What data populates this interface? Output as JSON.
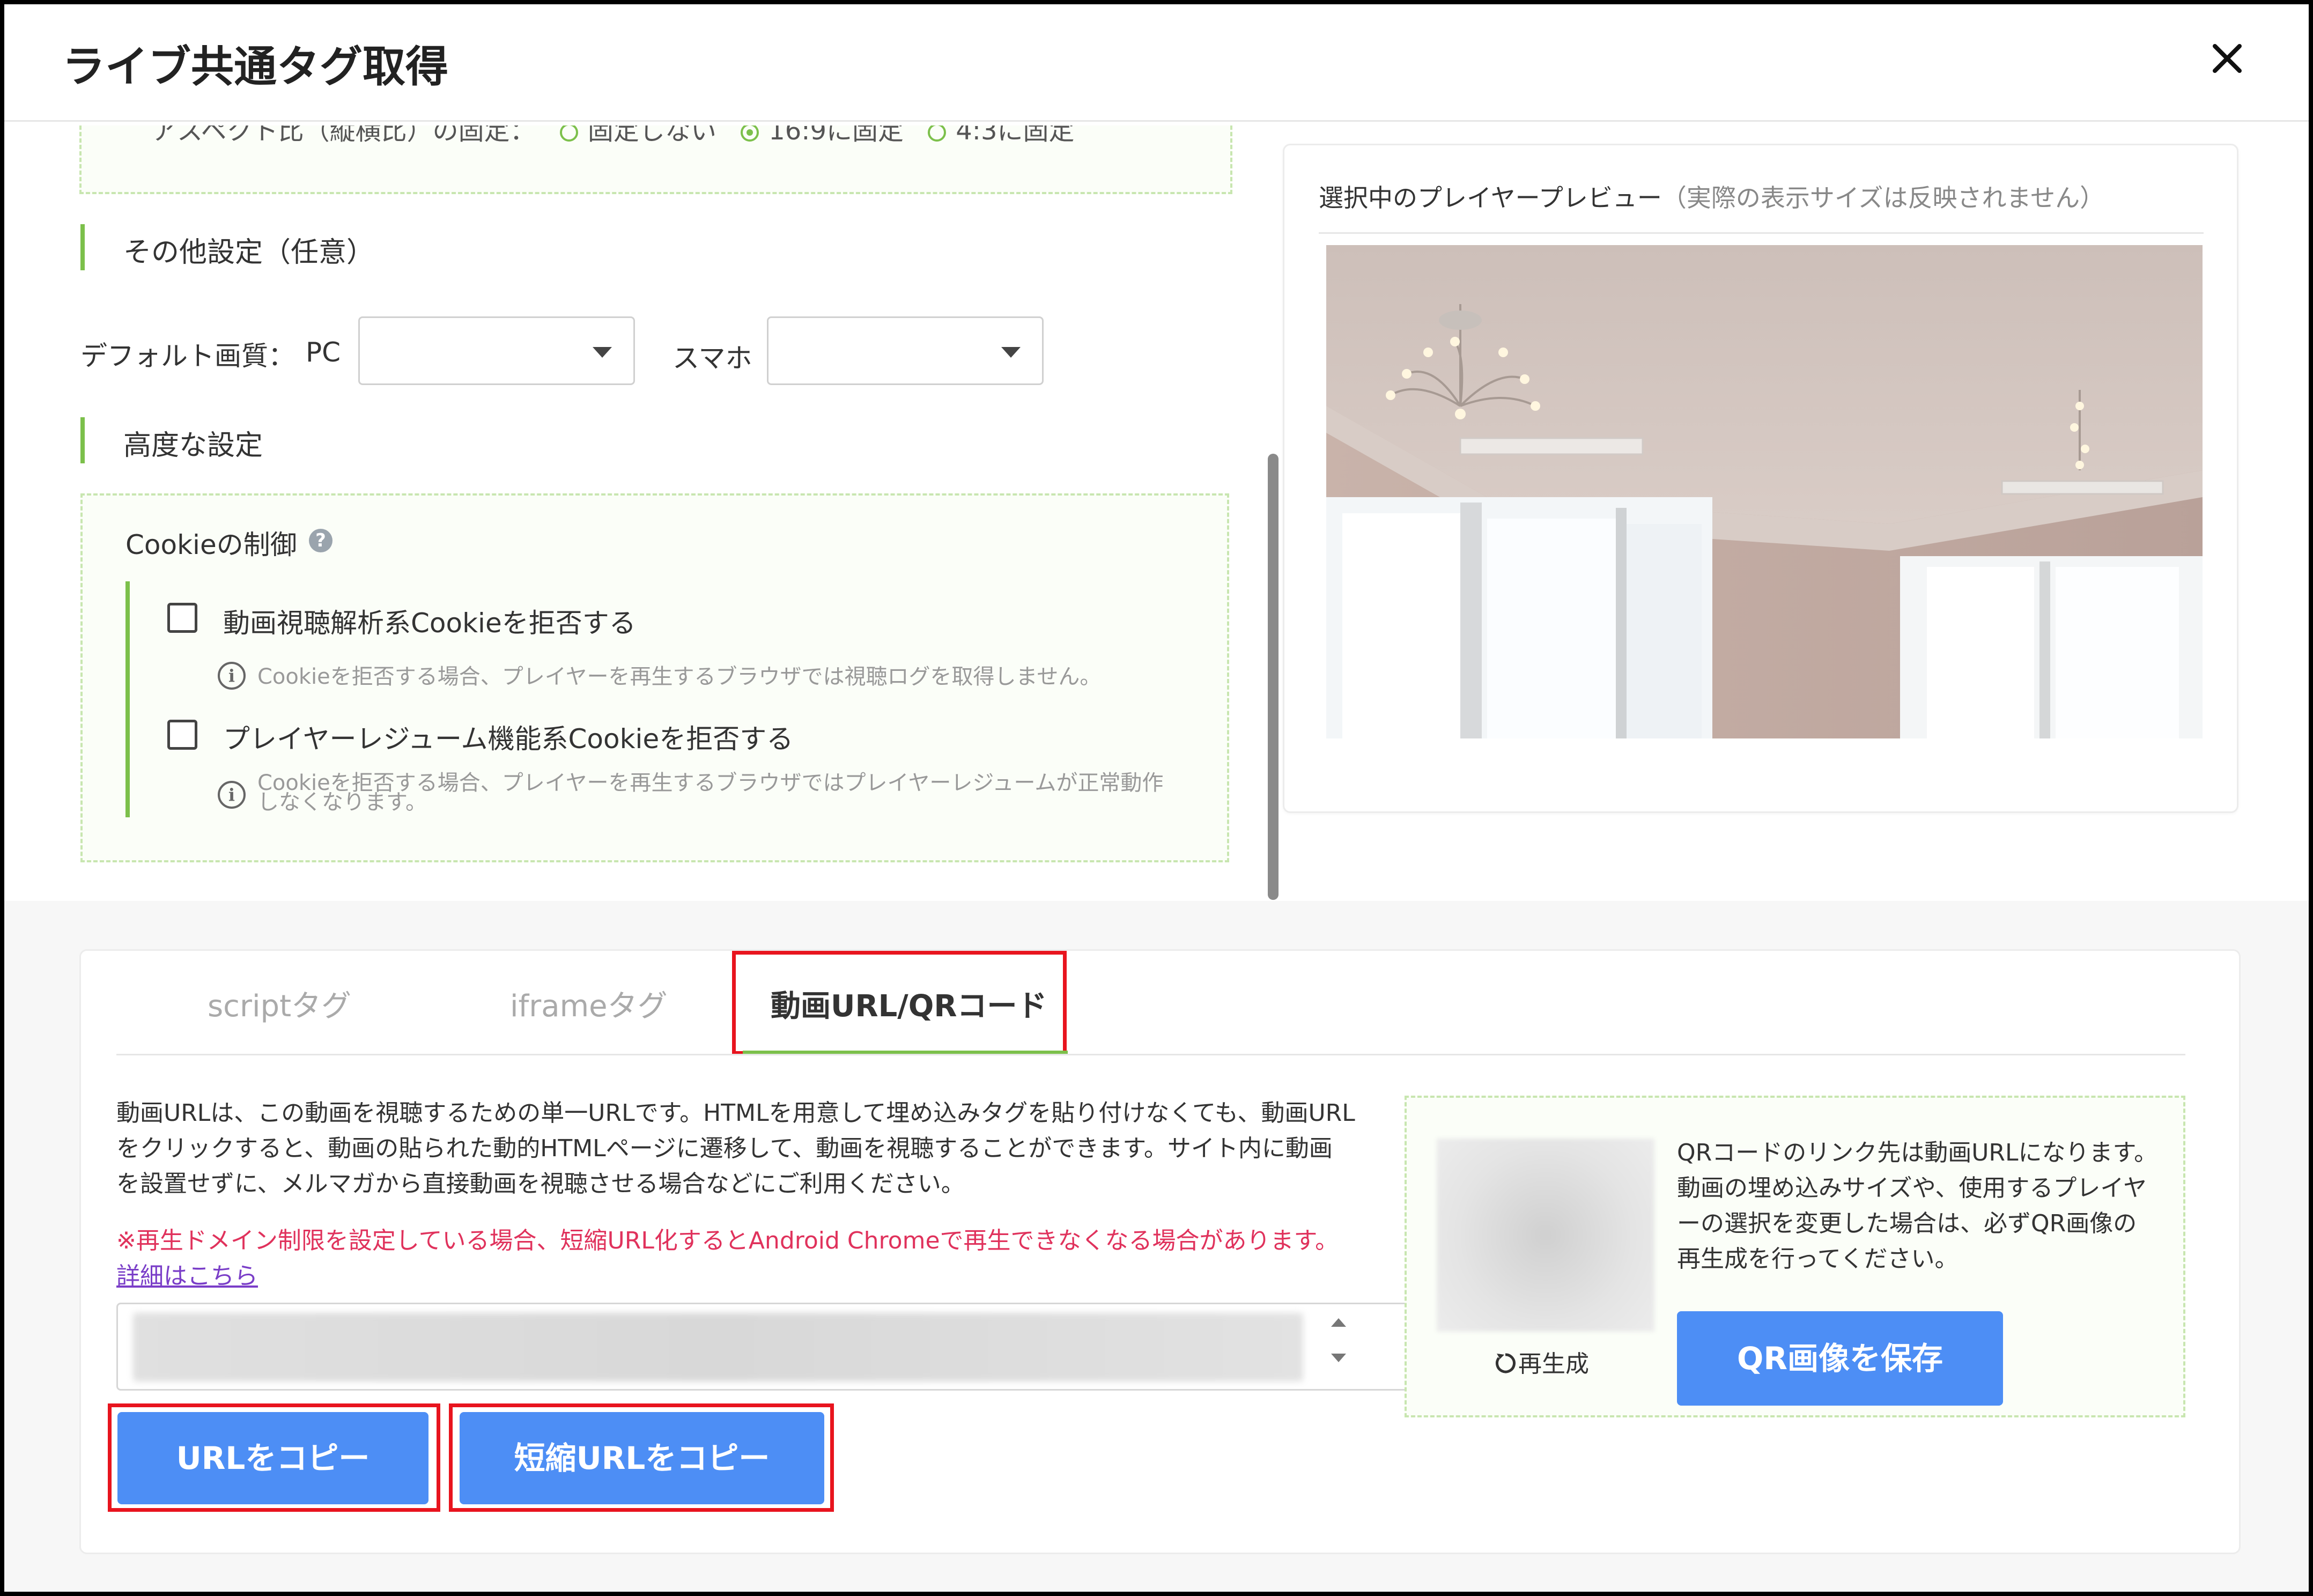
{
  "dialog": {
    "title": "ライブ共通タグ取得",
    "close_icon": "close-icon"
  },
  "aspect": {
    "label": "アスペクト比（縦横比）の固定：",
    "options": [
      "固定しない",
      "16:9に固定",
      "4:3に固定"
    ],
    "selected": "16:9に固定"
  },
  "other_settings": {
    "heading": "その他設定（任意）",
    "default_quality_label": "デフォルト画質：",
    "pc_label": "PC",
    "pc_value": "",
    "sp_label": "スマホ",
    "sp_value": ""
  },
  "advanced": {
    "heading": "高度な設定",
    "cookie_title": "Cookieの制御",
    "help_icon": "?",
    "options": [
      {
        "label": "動画視聴解析系Cookieを拒否する",
        "checked": false,
        "note": "Cookieを拒否する場合、プレイヤーを再生するブラウザでは視聴ログを取得しません。"
      },
      {
        "label": "プレイヤーレジューム機能系Cookieを拒否する",
        "checked": false,
        "note_line1": "Cookieを拒否する場合、プレイヤーを再生するブラウザではプレイヤーレジュームが正常動作",
        "note_line2": "しなくなります。"
      }
    ]
  },
  "preview": {
    "title": "選択中のプレイヤープレビュー",
    "subtitle": "（実際の表示サイズは反映されません）"
  },
  "tabs": {
    "items": [
      "scriptタグ",
      "iframeタグ",
      "動画URL/QRコード"
    ],
    "active": "動画URL/QRコード"
  },
  "video_url": {
    "description_1": "動画URLは、この動画を視聴するための単一URLです。HTMLを用意して埋め込みタグを貼り付けなくても、動画URL",
    "description_2": "をクリックすると、動画の貼られた動的HTMLページに遷移して、動画を視聴することができます。サイト内に動画",
    "description_3": "を設置せずに、メルマガから直接動画を視聴させる場合などにご利用ください。",
    "warning": "※再生ドメイン制限を設定している場合、短縮URL化するとAndroid Chromeで再生できなくなる場合があります。",
    "detail_link": "詳細はこちら",
    "copy_url_button": "URLをコピー",
    "copy_short_url_button": "短縮URLをコピー"
  },
  "qr": {
    "regenerate": "再生成",
    "description_1": "QRコードのリンク先は動画URLになります。",
    "description_2": "動画の埋め込みサイズや、使用するプレイヤ",
    "description_3": "ーの選択を変更した場合は、必ずQR画像の",
    "description_4": "再生成を行ってください。",
    "save_button": "QR画像を保存"
  },
  "colors": {
    "accent_green": "#7cc04b",
    "button_blue": "#4d8ef5",
    "warning_red": "#e0325c",
    "link_purple": "#7a3ec8",
    "highlight_red": "#e8141e"
  }
}
